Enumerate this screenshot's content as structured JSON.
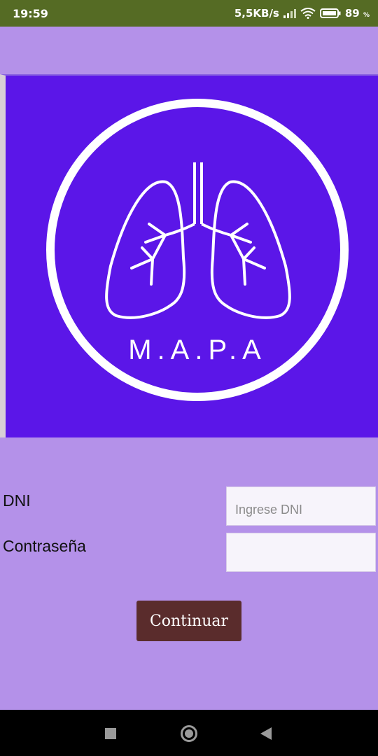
{
  "status_bar": {
    "time": "19:59",
    "network_speed": "5,5KB/s",
    "battery_percent": "89",
    "battery_unit": "%",
    "icons": [
      "signal-icon",
      "wifi-icon",
      "battery-icon"
    ]
  },
  "logo": {
    "brand_text": "M.A.P.A",
    "background_color": "#5b16e8",
    "stroke_color": "#ffffff"
  },
  "form": {
    "dni_label": "DNI",
    "dni_placeholder": "Ingrese DNI",
    "dni_value": "",
    "password_label": "Contraseña",
    "password_value": "",
    "continue_label": "Continuar"
  },
  "colors": {
    "app_background": "#b491e9",
    "status_bar": "#556b24",
    "button": "#5a2c2c"
  },
  "nav_bar": {
    "icons": [
      "recents-icon",
      "home-icon",
      "back-icon"
    ]
  }
}
